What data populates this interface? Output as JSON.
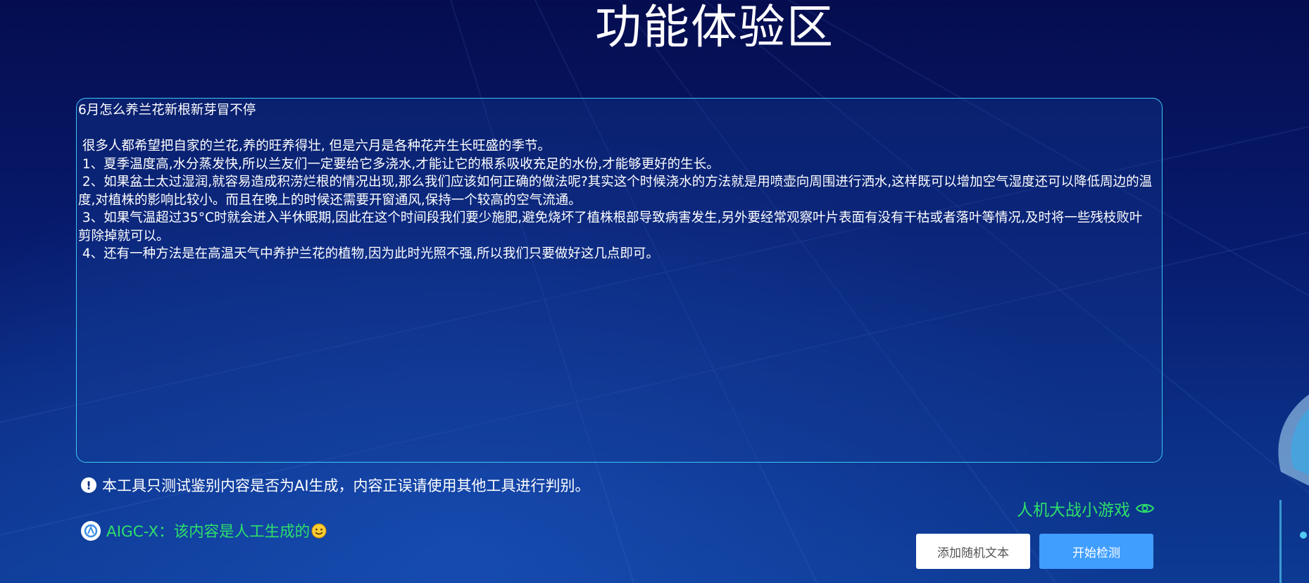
{
  "page": {
    "title": "功能体验区"
  },
  "editor": {
    "lines": [
      "6月怎么养兰花新根新芽冒不停",
      "",
      " 很多人都希望把自家的兰花,养的旺养得壮, 但是六月是各种花卉生长旺盛的季节。",
      " 1、夏季温度高,水分蒸发快,所以兰友们一定要给它多浇水,才能让它的根系吸收充足的水份,才能够更好的生长。",
      " 2、如果盆土太过湿润,就容易造成积涝烂根的情况出现,那么我们应该如何正确的做法呢?其实这个时候浇水的方法就是用喷壶向周围进行洒水,这样既可以增加空气湿度还可以降低周边的温度,对植株的影响比较小。而且在晚上的时候还需要开窗通风,保持一个较高的空气流通。",
      " 3、如果气温超过35°C时就会进入半休眠期,因此在这个时间段我们要少施肥,避免烧坏了植株根部导致病害发生,另外要经常观察叶片表面有没有干枯或者落叶等情况,及时将一些残枝败叶剪除掉就可以。",
      " 4、还有一种方法是在高温天气中养护兰花的植物,因为此时光照不强,所以我们只要做好这几点即可。"
    ]
  },
  "notice": {
    "icon": "exclamation-circle-icon",
    "text": "本工具只测试鉴别内容是否为AI生成，内容正误请使用其他工具进行判别。"
  },
  "game_link": {
    "label": "人机大战小游戏",
    "icon": "eye-icon",
    "color": "#2ee06a"
  },
  "result": {
    "logo": "aigc-x-logo-icon",
    "text": "AIGC-X：该内容是人工生成的",
    "emoji": "smile-emoji-icon",
    "color": "#2ee06a"
  },
  "buttons": {
    "add_random": "添加随机文本",
    "start_detect": "开始检测",
    "primary_color": "#409eff"
  }
}
